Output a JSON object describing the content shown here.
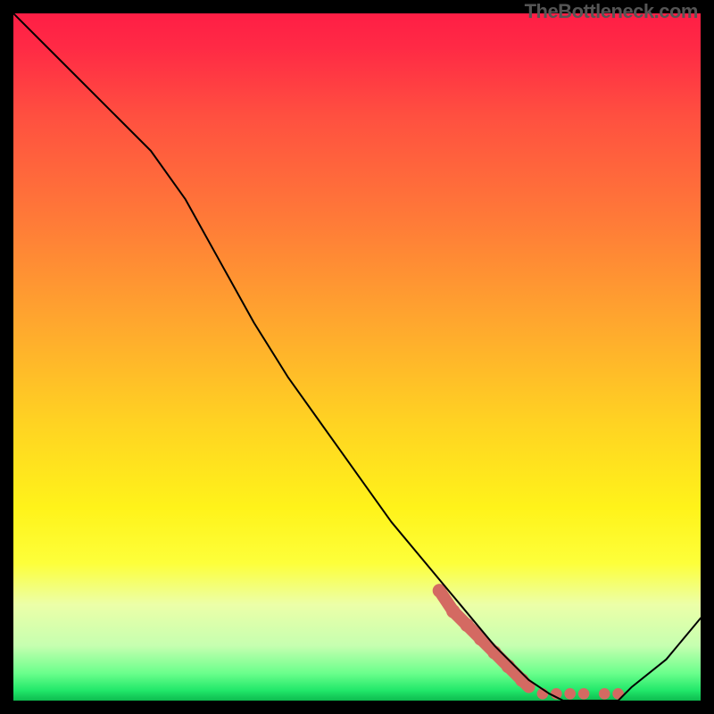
{
  "watermark": "TheBottleneck.com",
  "chart_data": {
    "type": "line",
    "title": "",
    "xlabel": "",
    "ylabel": "",
    "xlim": [
      0,
      100
    ],
    "ylim": [
      0,
      100
    ],
    "grid": false,
    "series": [
      {
        "name": "curve",
        "x": [
          0,
          5,
          10,
          15,
          20,
          25,
          30,
          35,
          40,
          45,
          50,
          55,
          60,
          65,
          70,
          75,
          78,
          80,
          82,
          85,
          88,
          90,
          95,
          100
        ],
        "y": [
          100,
          95,
          90,
          85,
          80,
          73,
          64,
          55,
          47,
          40,
          33,
          26,
          20,
          14,
          8,
          3,
          1,
          0,
          0,
          0,
          0,
          2,
          6,
          12
        ],
        "stroke": "#000000",
        "stroke_width": 2
      }
    ],
    "highlight_segment": {
      "name": "valley-highlight",
      "x": [
        62,
        64,
        66,
        68,
        70,
        72,
        74,
        75,
        77,
        79,
        81,
        83,
        86,
        88
      ],
      "y": [
        16,
        13,
        11,
        9,
        7,
        5,
        3,
        2,
        1,
        1,
        1,
        1,
        1,
        1
      ],
      "color": "#d46a62",
      "stroke_width": 14
    },
    "gradient_stops": [
      {
        "offset": 0,
        "color": "#ff1e45"
      },
      {
        "offset": 0.05,
        "color": "#ff2a45"
      },
      {
        "offset": 0.15,
        "color": "#ff5040"
      },
      {
        "offset": 0.3,
        "color": "#ff7a38"
      },
      {
        "offset": 0.45,
        "color": "#ffa72e"
      },
      {
        "offset": 0.6,
        "color": "#ffd422"
      },
      {
        "offset": 0.72,
        "color": "#fff31a"
      },
      {
        "offset": 0.8,
        "color": "#fdff3a"
      },
      {
        "offset": 0.86,
        "color": "#ecffa8"
      },
      {
        "offset": 0.92,
        "color": "#c6ffb0"
      },
      {
        "offset": 0.96,
        "color": "#6bff8c"
      },
      {
        "offset": 0.985,
        "color": "#22e86a"
      },
      {
        "offset": 1.0,
        "color": "#0dbb4f"
      }
    ]
  }
}
